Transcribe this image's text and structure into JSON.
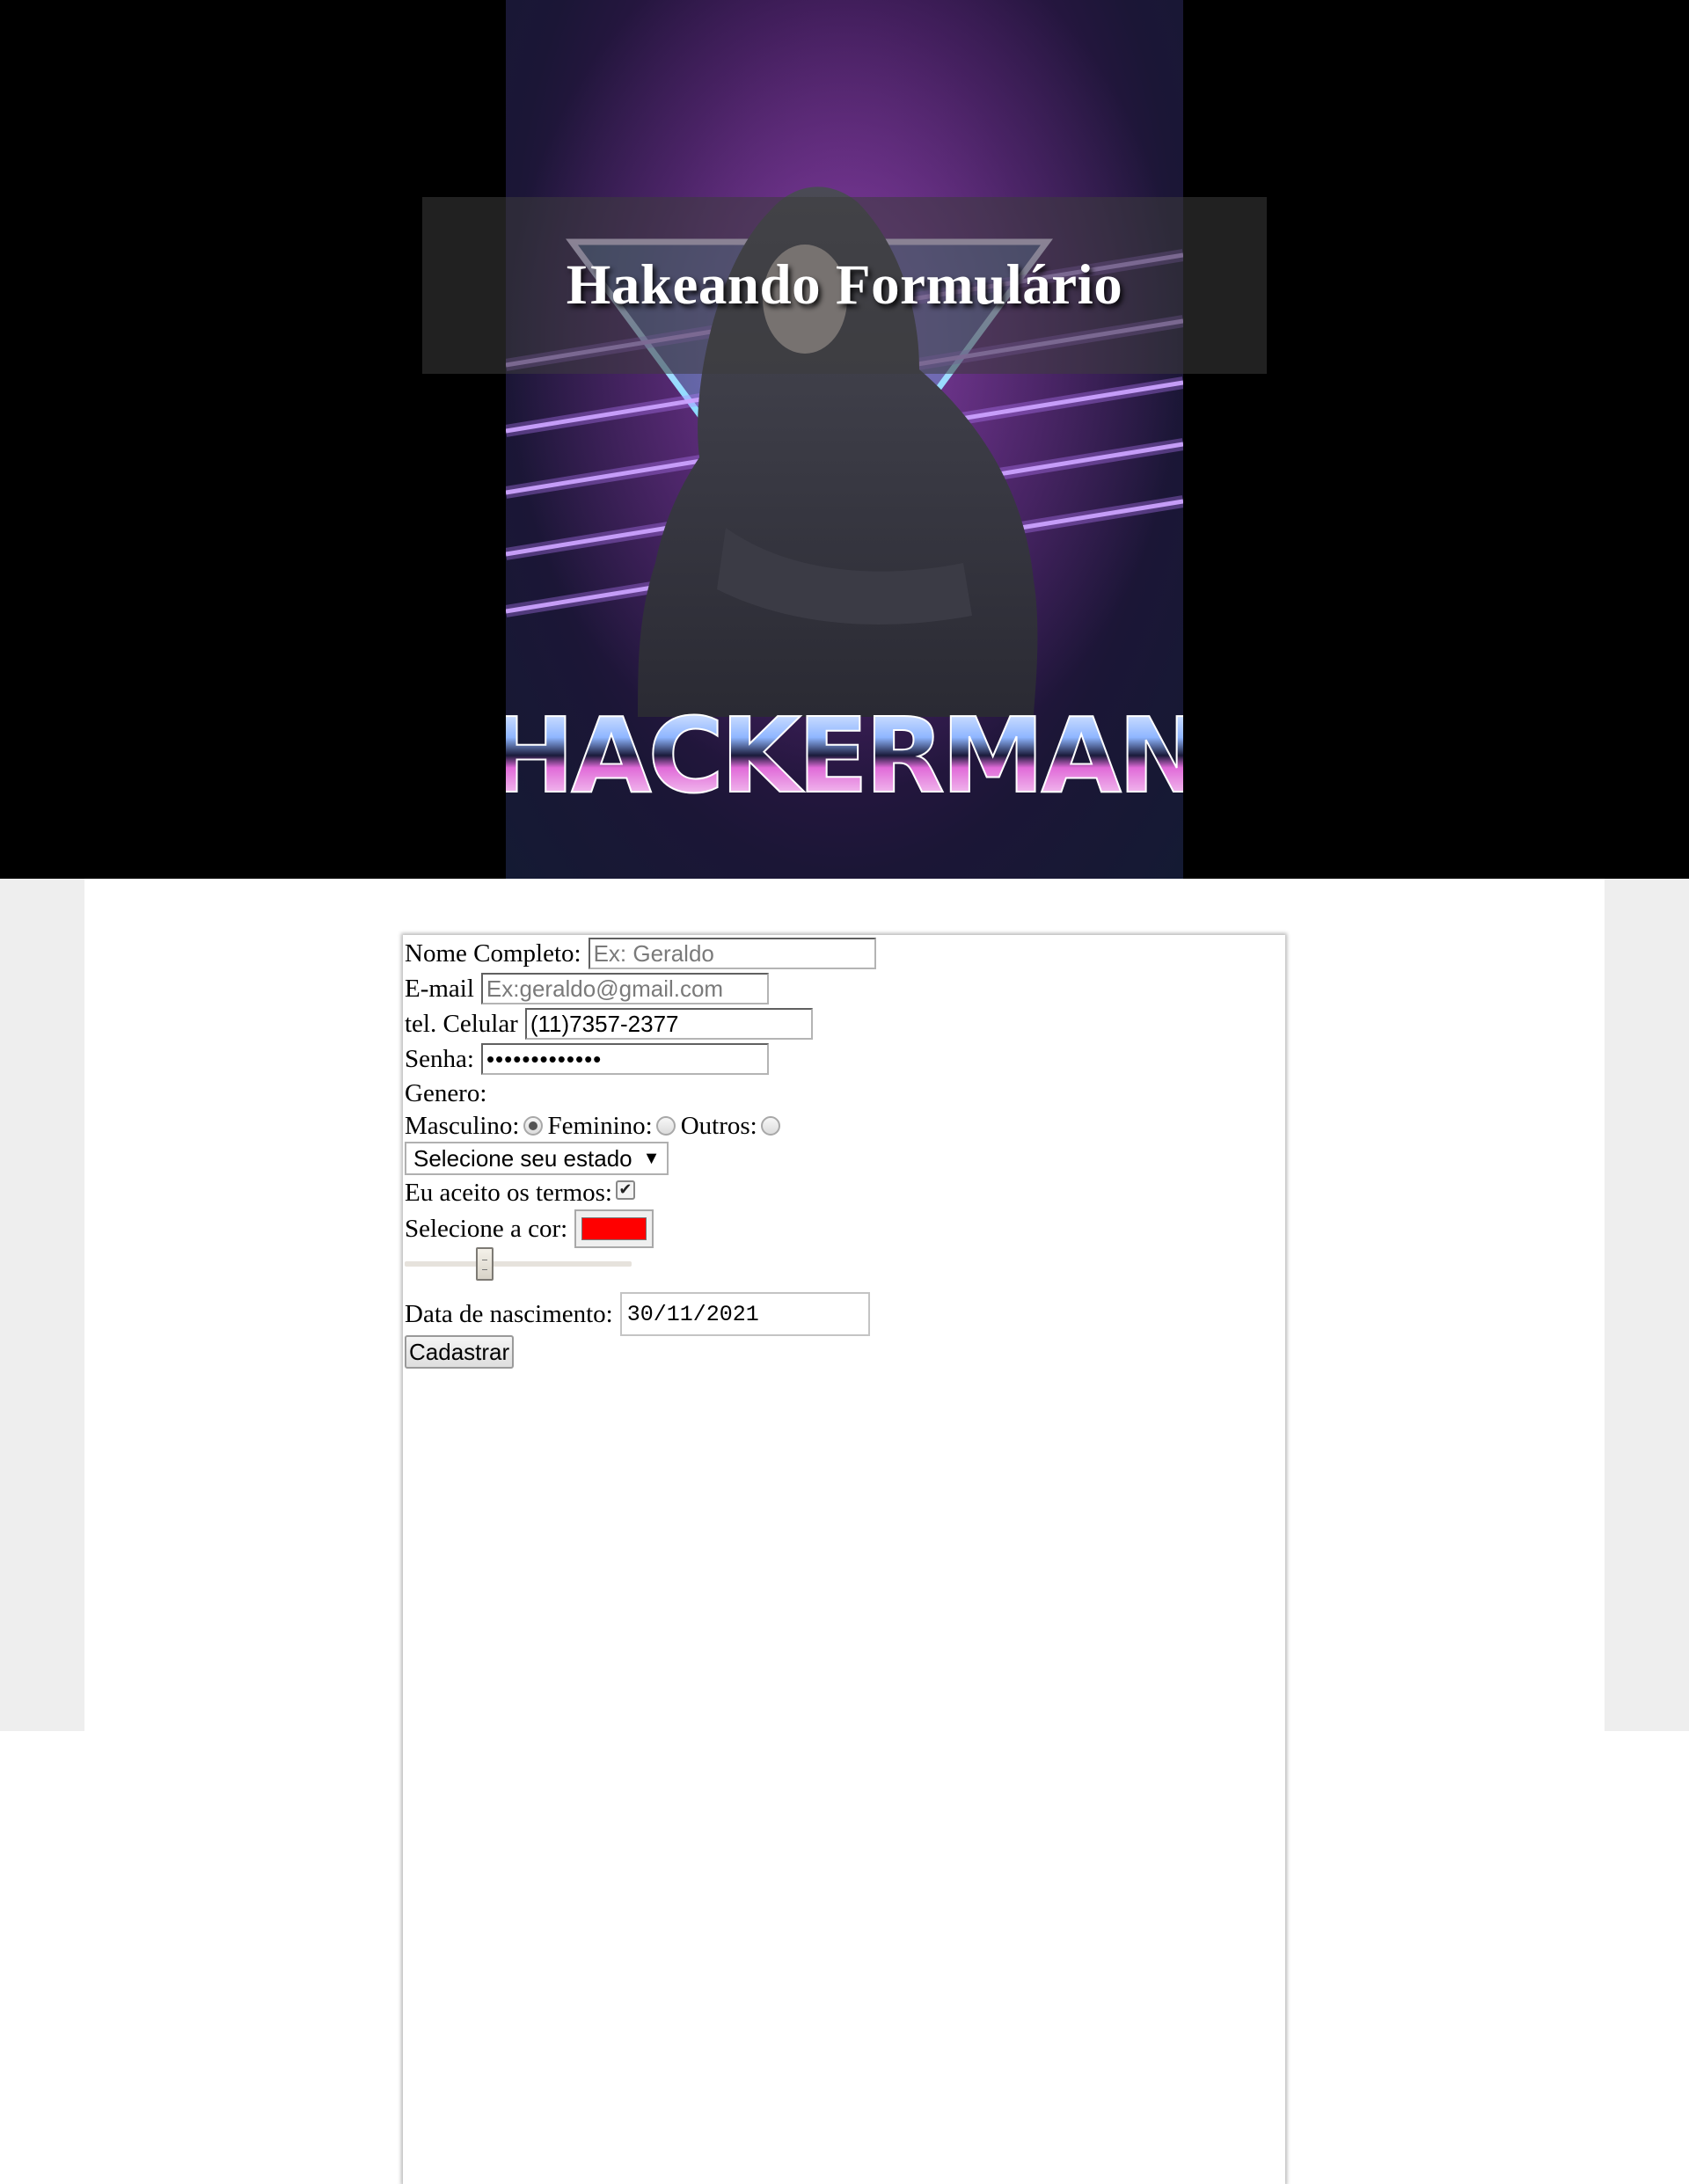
{
  "header": {
    "title": "Hakeando Formulário",
    "poster_wordmark": "HACKERMAN"
  },
  "form": {
    "nome": {
      "label": "Nome Completo:",
      "placeholder": "Ex: Geraldo",
      "value": ""
    },
    "email": {
      "label": "E-mail",
      "placeholder": "Ex:geraldo@gmail.com",
      "value": ""
    },
    "celular": {
      "label": "tel. Celular",
      "value": "(11)7357-2377"
    },
    "senha": {
      "label": "Senha:",
      "value": "•••••••••••••"
    },
    "genero": {
      "label": "Genero:",
      "options": [
        "Masculino:",
        "Feminino:",
        "Outros:"
      ],
      "selected": "Masculino:"
    },
    "estado": {
      "selected_text": "Selecione seu estado",
      "arrow": "▼"
    },
    "termos": {
      "label": "Eu aceito os termos:",
      "checked": true,
      "check_glyph": "✔"
    },
    "cor": {
      "label": "Selecione a cor:",
      "value": "#ff0000"
    },
    "range": {
      "value_fraction": 0.34
    },
    "nascimento": {
      "label": "Data de nascimento:",
      "value": "30/11/2021"
    },
    "submit_label": "Cadastrar"
  },
  "colors": {
    "page_grey": "#eeeeee",
    "hero_bg": "#000000",
    "neon_purple": "#b77cff"
  }
}
